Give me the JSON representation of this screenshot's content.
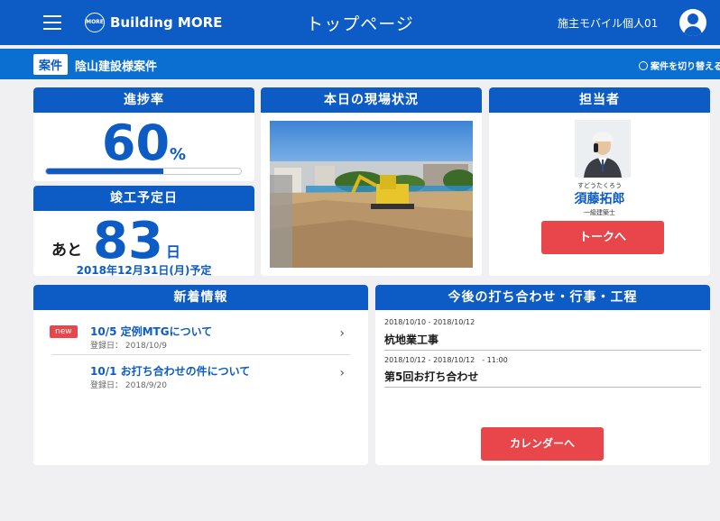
{
  "header": {
    "brand": "Building MORE",
    "brand_mark": "MORE",
    "page_title": "トップページ",
    "user_name": "施主モバイル個人01"
  },
  "project": {
    "tag": "案件",
    "name": "陰山建設様案件",
    "switch_label": "案件を切り替える"
  },
  "progress": {
    "heading": "進捗率",
    "value": "60",
    "unit": "%",
    "fraction": 0.6
  },
  "completion": {
    "heading": "竣工予定日",
    "prefix": "あと",
    "days": "83",
    "suffix": "日",
    "date_label": "2018年12月31日(月)予定"
  },
  "site": {
    "heading": "本日の現場状況"
  },
  "staff": {
    "heading": "担当者",
    "kana": "すどうたくろう",
    "name": "須藤拓郎",
    "title": "一級建築士",
    "talk_button": "トークへ"
  },
  "news": {
    "heading": "新着情報",
    "items": [
      {
        "badge": "new",
        "title": "10/5 定例MTGについて",
        "date": "登録日： 2018/10/9"
      },
      {
        "badge": "",
        "title": "10/1 お打ち合わせの件について",
        "date": "登録日： 2018/9/20"
      }
    ]
  },
  "schedule": {
    "heading": "今後の打ち合わせ・行事・工程",
    "items": [
      {
        "date": "2018/10/10 - 2018/10/12",
        "title": "杭地業工事"
      },
      {
        "date": "2018/10/12 - 2018/10/12　- 11:00",
        "title": "第5回お打ち合わせ"
      }
    ],
    "calendar_button": "カレンダーへ"
  },
  "colors": {
    "primary": "#0d5bc5",
    "accent": "#e8464a",
    "background": "#f0f0f2"
  },
  "icons": {
    "menu": "hamburger-icon",
    "logo": "building-logo-icon",
    "user": "user-avatar-icon",
    "switch": "refresh-icon",
    "chevron": "chevron-right-icon"
  }
}
